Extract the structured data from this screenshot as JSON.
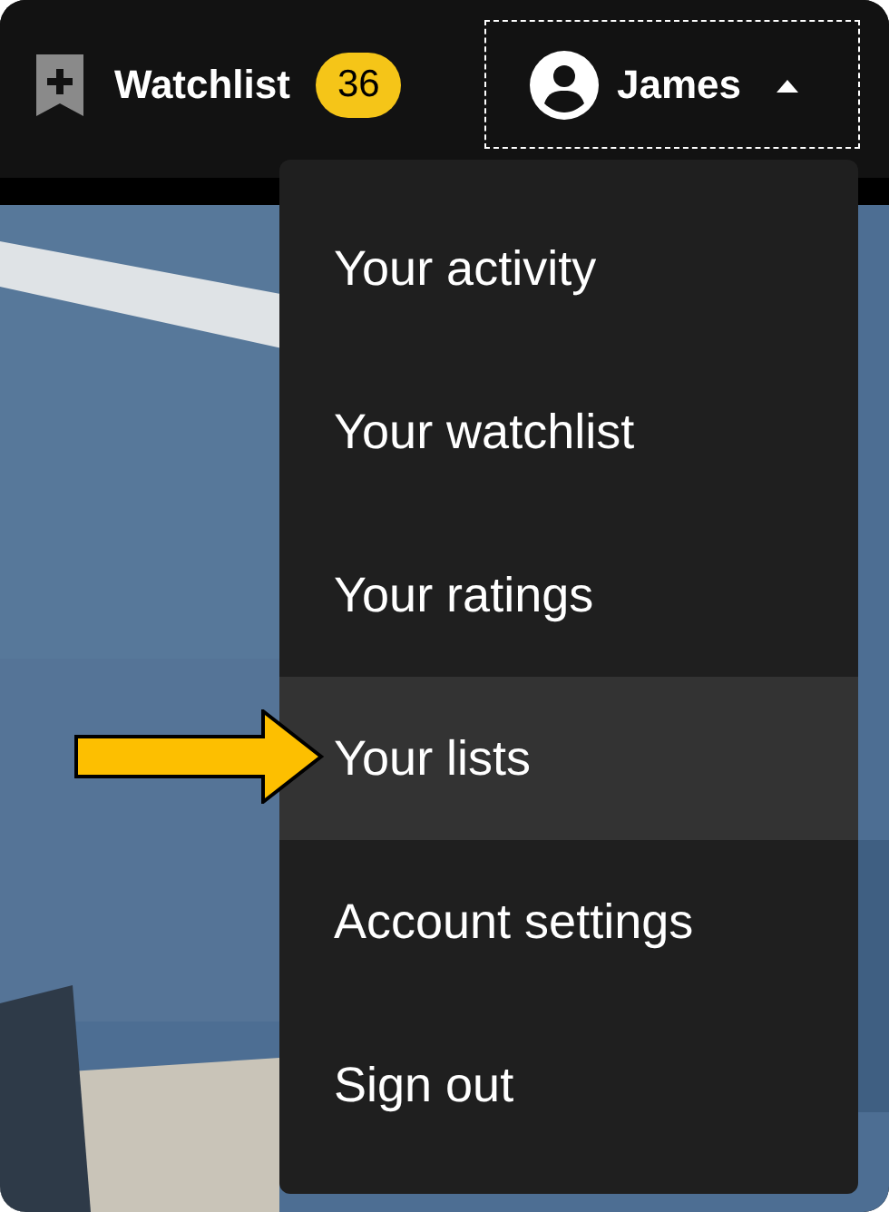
{
  "header": {
    "watchlist": {
      "label": "Watchlist",
      "count": "36"
    },
    "user": {
      "name": "James",
      "expanded": true
    }
  },
  "menu": {
    "items": [
      {
        "label": "Your activity",
        "selected": false,
        "pointed": false
      },
      {
        "label": "Your watchlist",
        "selected": false,
        "pointed": false
      },
      {
        "label": "Your ratings",
        "selected": false,
        "pointed": false
      },
      {
        "label": "Your lists",
        "selected": true,
        "pointed": true
      },
      {
        "label": "Account settings",
        "selected": false,
        "pointed": false
      },
      {
        "label": "Sign out",
        "selected": false,
        "pointed": false
      }
    ]
  }
}
